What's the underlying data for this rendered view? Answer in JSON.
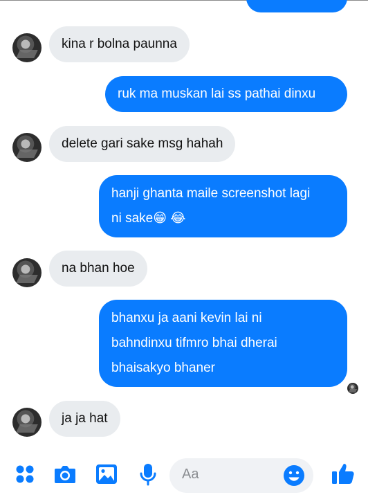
{
  "messages": [
    {
      "dir": "out",
      "text": ""
    },
    {
      "dir": "in",
      "text": "kina r bolna paunna"
    },
    {
      "dir": "out",
      "text": "ruk ma muskan lai ss pathai dinxu"
    },
    {
      "dir": "in",
      "text": "delete gari sake msg hahah"
    },
    {
      "dir": "out",
      "lines": [
        "hanji ghanta maile screenshot lagi",
        "ni sake😁 😂"
      ]
    },
    {
      "dir": "in",
      "text": "na bhan hoe"
    },
    {
      "dir": "out",
      "lines": [
        "bhanxu ja aani kevin lai ni",
        "bahndinxu tifmro bhai dherai",
        "bhaisakyo bhaner"
      ]
    },
    {
      "dir": "in",
      "text": "ja ja hat"
    }
  ],
  "composer": {
    "placeholder": "Aa",
    "icons": [
      "more-icon",
      "camera-icon",
      "image-icon",
      "microphone-icon",
      "emoji-icon",
      "like-icon"
    ],
    "accent": "#0a7cff"
  }
}
